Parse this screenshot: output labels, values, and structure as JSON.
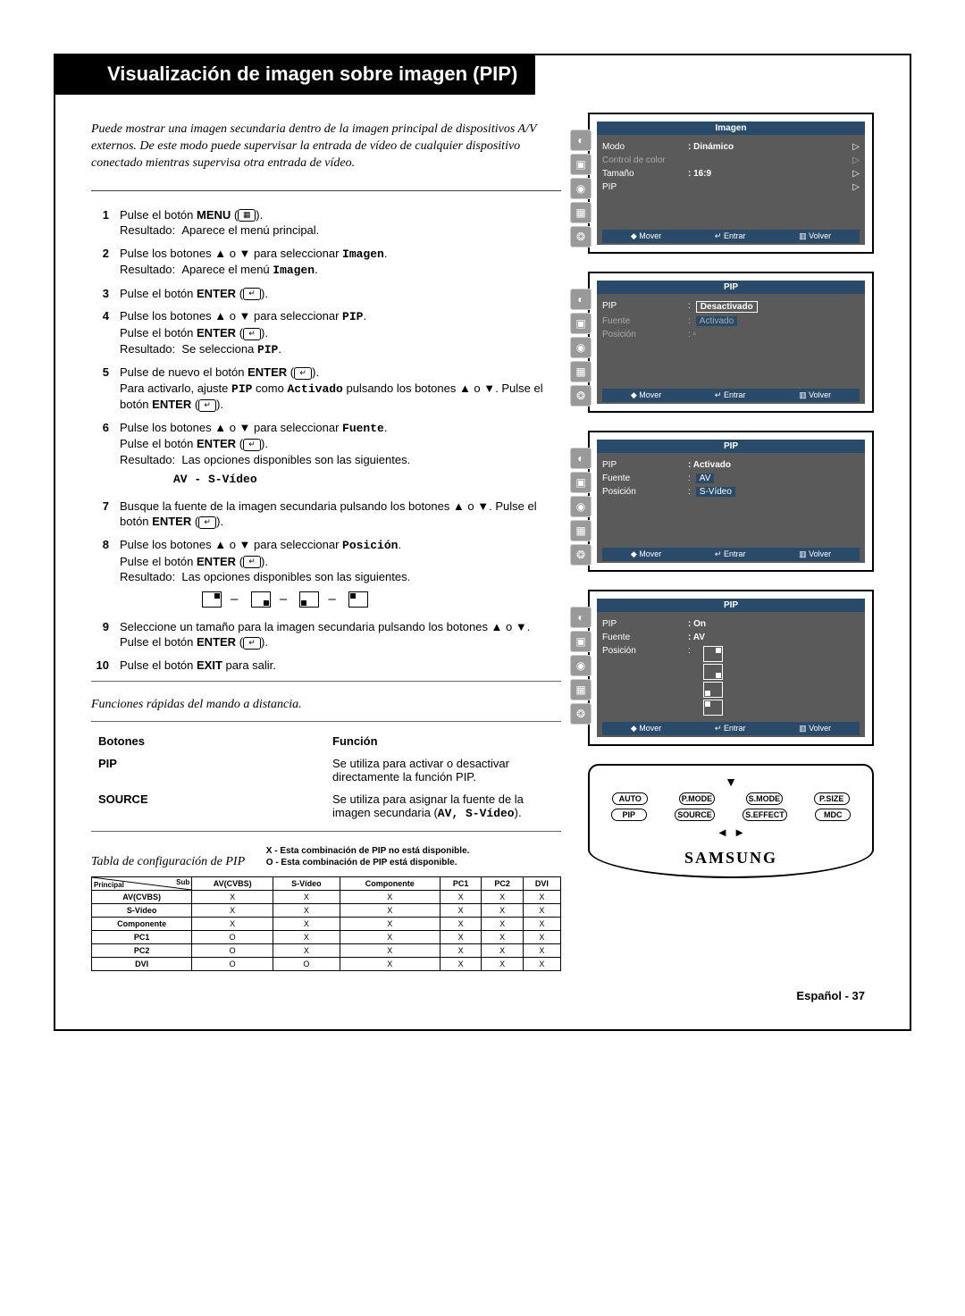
{
  "title": "Visualización de imagen sobre imagen (PIP)",
  "intro": "Puede mostrar una imagen secundaria dentro de la imagen principal de dispositivos A/V externos. De este modo puede supervisar la entrada de vídeo de cualquier dispositivo conectado mientras supervisa otra entrada de vídeo.",
  "steps": {
    "s1a": "Pulse el botón ",
    "s1b": "MENU",
    "s1c": "Resultado:  Aparece el menú principal.",
    "s2a": "Pulse los botones ▲ o ▼ para seleccionar ",
    "s2b": "Imagen",
    "s2c": "Resultado:  Aparece el menú ",
    "s2d": "Imagen",
    "s3a": "Pulse el botón ",
    "s3b": "ENTER",
    "s4a": "Pulse los botones ▲ o ▼ para seleccionar ",
    "s4b": "PIP",
    "s4c": "Pulse el botón ",
    "s4d": "ENTER",
    "s4e": "Resultado:  Se selecciona ",
    "s4f": "PIP",
    "s5a": "Pulse de nuevo el botón ",
    "s5b": "ENTER",
    "s5c": "Para activarlo, ajuste ",
    "s5d": "PIP",
    "s5e": " como ",
    "s5f": "Activado",
    "s5g": " pulsando los botones ▲ o ▼. Pulse el botón ",
    "s5h": "ENTER",
    "s6a": "Pulse los botones ▲ o ▼ para seleccionar ",
    "s6b": "Fuente",
    "s6c": "Pulse el botón ",
    "s6d": "ENTER",
    "s6e": "Resultado:  Las opciones disponibles son las siguientes.",
    "s6f": "AV - S-Vídeo",
    "s7a": "Busque la fuente de la imagen secundaria pulsando los botones ▲ o ▼. Pulse el botón ",
    "s7b": "ENTER",
    "s8a": "Pulse los botones ▲ o ▼ para seleccionar ",
    "s8b": "Posición",
    "s8c": "Pulse el botón ",
    "s8d": "ENTER",
    "s8e": "Resultado:  Las opciones disponibles son las siguientes.",
    "s9a": "Seleccione un tamaño para la imagen secundaria pulsando los botones ▲ o ▼. Pulse el botón ",
    "s9b": "ENTER",
    "s10a": "Pulse el botón ",
    "s10b": "EXIT",
    "s10c": " para salir."
  },
  "quick_title": "Funciones rápidas del mando a distancia.",
  "bt": {
    "h1": "Botones",
    "h2": "Función",
    "r1k": "PIP",
    "r1v": "Se utiliza para activar o desactivar directamente la función PIP.",
    "r2k": "SOURCE",
    "r2va": "Se utiliza para asignar la fuente de la imagen secundaria (",
    "r2vb": "AV, S-Vídeo",
    "r2vc": ")."
  },
  "cfg_title": "Tabla de configuración de PIP",
  "cfg_legend_x": "X - Esta combinación de PIP no está disponible.",
  "cfg_legend_o": "O - Esta combinación de PIP está disponible.",
  "cfg": {
    "corner_main": "Principal",
    "corner_sub": "Sub",
    "cols": [
      "AV(CVBS)",
      "S-Vídeo",
      "Componente",
      "PC1",
      "PC2",
      "DVI"
    ],
    "rows": [
      {
        "h": "AV(CVBS)",
        "v": [
          "X",
          "X",
          "X",
          "X",
          "X",
          "X"
        ]
      },
      {
        "h": "S-Vídeo",
        "v": [
          "X",
          "X",
          "X",
          "X",
          "X",
          "X"
        ]
      },
      {
        "h": "Componente",
        "v": [
          "X",
          "X",
          "X",
          "X",
          "X",
          "X"
        ]
      },
      {
        "h": "PC1",
        "v": [
          "O",
          "X",
          "X",
          "X",
          "X",
          "X"
        ]
      },
      {
        "h": "PC2",
        "v": [
          "O",
          "X",
          "X",
          "X",
          "X",
          "X"
        ]
      },
      {
        "h": "DVI",
        "v": [
          "O",
          "O",
          "X",
          "X",
          "X",
          "X"
        ]
      }
    ]
  },
  "osd1": {
    "title": "Imagen",
    "r1l": "Modo",
    "r1v": ": Dinámico",
    "r2l": "Control de color",
    "r3l": "Tamaño",
    "r3v": ": 16:9",
    "r4l": "PIP"
  },
  "osd2": {
    "title": "PIP",
    "r1l": "PIP",
    "r1v": "Desactivado",
    "r2l": "Fuente",
    "r2v": "Activado",
    "r3l": "Posición"
  },
  "osd3": {
    "title": "PIP",
    "r1l": "PIP",
    "r1v": ": Activado",
    "r2l": "Fuente",
    "r2v": "AV",
    "r3l": "Posición",
    "r3v": "S-Vídeo"
  },
  "osd4": {
    "title": "PIP",
    "r1l": "PIP",
    "r1v": ": On",
    "r2l": "Fuente",
    "r2v": ": AV",
    "r3l": "Posición"
  },
  "osd_footer": {
    "a": "◆ Mover",
    "b": "↵ Entrar",
    "c": "▥ Volver"
  },
  "remote": {
    "row1": [
      "AUTO",
      "P.MODE",
      "S.MODE",
      "P.SIZE"
    ],
    "row2": [
      "PIP",
      "SOURCE",
      "S.EFFECT",
      "MDC"
    ],
    "brand": "SAMSUNG"
  },
  "page_footer": "Español - 37"
}
